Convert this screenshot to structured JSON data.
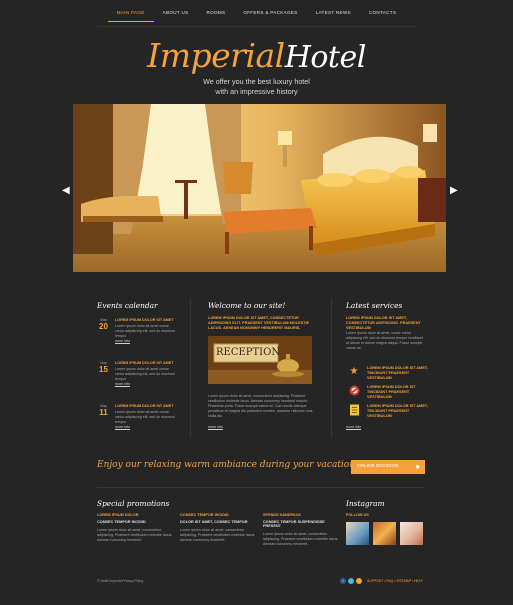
{
  "nav": {
    "items": [
      {
        "label": "MAIN PAGE",
        "active": true
      },
      {
        "label": "ABOUT US",
        "active": false
      },
      {
        "label": "ROOMS",
        "active": false
      },
      {
        "label": "OFFERS & PACKAGES",
        "active": false
      },
      {
        "label": "LATEST NEWS",
        "active": false
      },
      {
        "label": "CONTACTS",
        "active": false
      }
    ]
  },
  "logo": {
    "word1": "Imperial",
    "word2": "Hotel"
  },
  "tagline": {
    "line1": "We offer you the best luxury hotel",
    "line2": "with an impressive history"
  },
  "slider": {
    "prev_icon": "chevron-left-icon",
    "next_icon": "chevron-right-icon"
  },
  "events": {
    "title": "Events calendar",
    "items": [
      {
        "month": "May",
        "day": "20",
        "title": "LOREM IPSUM DOLOR SIT AMET",
        "desc": "Lorem ipsum dolor sit amet conse ctetur adipisicing elit, sed do eiusmod tempor.",
        "more": "more info"
      },
      {
        "month": "May",
        "day": "15",
        "title": "LOREM IPSUM DOLOR SIT AMET",
        "desc": "Lorem ipsum dolor sit amet conse ctetur adipisicing elit, sed do eiusmod tempor.",
        "more": "more info"
      },
      {
        "month": "May",
        "day": "11",
        "title": "LOREM IPSUM DOLOR SIT AMET",
        "desc": "Lorem ipsum dolor sit amet conse ctetur adipisicing elit, sed do eiusmod tempor.",
        "more": "more info"
      }
    ]
  },
  "welcome": {
    "title": "Welcome to our site!",
    "intro": "LOREM IPSUM DOLOR SIT AMET, CONSECTETUR ADIPISICING ELIT. PRAESENT VESTIBULUM MOLESTIE LACUS. AENEAN NONUMMY HENDRERIT MAURIS.",
    "image_text": "RECEPTION",
    "body": "Lorem ipsum dolor sit amet, consectetur adipiscing. Praesent vestibulum molestie lacus. Aenean nonummy hendrerit mauris. Phasellus porta. Fusce suscipit varius mi. Cum sociis natoque penatibus et magnis dis parturient montes, nascetur ridiculus mus. Nulla dui.",
    "more": "more info"
  },
  "services": {
    "title": "Latest services",
    "intro_title": "LOREM IPSUM DOLOR SIT AMET, CONSECTETUR ADIPISCING. PRAESENT VESTIBULUM",
    "intro_body": "Lorem ipsum dolor sit amet, conse ctetur adipiscing elit, sed do eiusmod tempor incididunt ut labore et dolore magna aliqua. Fusce suscipit varius mi.",
    "items": [
      {
        "icon": "star-icon",
        "title": "LOREM IPSUM DOLOR SIT AMET, TINCIDUNT PRAESENT VESTIBULUM"
      },
      {
        "icon": "no-sign-icon",
        "title": "LOREM IPSUM DOLOR SIT TINCIDUNT PRAESENT VESTIBULUM"
      },
      {
        "icon": "document-icon",
        "title": "LOREM IPSUM DOLOR SIT AMET, TINCIDUNT PRAESENT VESTIBULUM"
      }
    ],
    "more": "more info"
  },
  "banner": {
    "text": "Enjoy our relaxing warm ambiance during your vacation !",
    "button_label": "ONLINE BOOKING",
    "button_icon": "speech-bubble-icon"
  },
  "promotions": {
    "title": "Special promotions",
    "items": [
      {
        "heading": "LOREM IPSUM DOLOR",
        "sub": "CONSEC TEMPOR INCIDID",
        "body": "Lorem ipsum dolor sit amet, consectetur adipiscing. Praesent vestibulum molestie lacus. Aenean nonummy hendrerit."
      },
      {
        "heading": "CONSEC TEMPOR INCIDID",
        "sub": "DOLOR SIT AMET, CONSEC TEMPOR",
        "body": "Lorem ipsum dolor sit amet, consectetur adipiscing. Praesent vestibulum molestie lacus. Aenean nonummy hendrerit."
      },
      {
        "heading": "SPENDS HANDPACK",
        "sub": "CONSEC TEMPOR SUSPENDISSE PRESENT",
        "body": "Lorem ipsum dolor sit amet, consectetur adipiscing. Praesent vestibulum molestie lacus. Aenean nonummy hendrerit."
      }
    ]
  },
  "instagram": {
    "title": "Instagram",
    "handle": "FOLLOW US"
  },
  "footer": {
    "copyright": "© Hotel Imperial Privacy Policy",
    "links": "SUPPORT  •  FAQ  •  SITEMAP  •  HELP",
    "social": [
      "facebook-icon",
      "twitter-icon",
      "rss-icon"
    ]
  },
  "colors": {
    "accent": "#f6a23a",
    "background": "#252525"
  }
}
